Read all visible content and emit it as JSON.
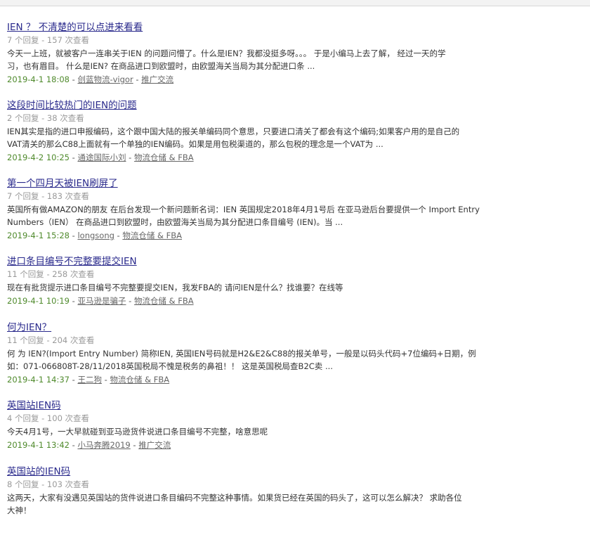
{
  "results": [
    {
      "title": "IEN ？ 不清楚的可以点进来看看",
      "stats": "7 个回复 - 157 次查看",
      "snippet": [
        "今天一上班，就被客户一连串关于IEN 的问题问懵了。什么是IEN？我都没挺多呀。。。 于是小编马上去了解， 经过一天的学",
        "习，也有眉目。 什么是IEN? 在商品进口到欧盟时，由欧盟海关当局为其分配进口条 ..."
      ],
      "date": "2019-4-1 18:08",
      "author": "创蓝物流-vigor",
      "forum": "推广交流"
    },
    {
      "title": "这段时间比较热门的IEN的问题",
      "stats": "2 个回复 - 38 次查看",
      "snippet": [
        "IEN其实是指的进口申报编码，这个跟中国大陆的报关单编码同个意思，只要进口清关了都会有这个编码;如果客户用的是自己的",
        "VAT清关的那么C88上面就有一个单独的IEN编码。如果是用包税渠道的，那么包税的理念是一个VAT为 ..."
      ],
      "date": "2019-4-2 10:25",
      "author": "通途国际小刘",
      "forum": "物流仓储 & FBA"
    },
    {
      "title": "第一个四月天被IEN刷屏了",
      "stats": "7 个回复 - 183 次查看",
      "snippet": [
        "英国所有做AMAZON的朋友 在后台发现一个新问题新名词：IEN 英国规定2018年4月1号后 在亚马逊后台要提供一个 Import Entry",
        "Numbers（IEN） 在商品进口到欧盟时，由欧盟海关当局为其分配进口条目编号 (IEN)。当 ..."
      ],
      "date": "2019-4-1 15:28",
      "author": "longsong",
      "forum": "物流仓储 & FBA"
    },
    {
      "title": "进口条目编号不完整要提交IEN",
      "stats": "11 个回复 - 258 次查看",
      "snippet": [
        "现在有批货提示进口条目编号不完整要提交IEN，我发FBA的 请问IEN是什么？找谁要？在线等"
      ],
      "date": "2019-4-1 10:19",
      "author": "亚马逊是骗子",
      "forum": "物流仓储 & FBA"
    },
    {
      "title": "何为IEN？",
      "stats": "11 个回复 - 204 次查看",
      "snippet": [
        "何 为 IEN?(Import Entry Number) 简称IEN, 英国IEN号码就是H2&E2&C88的报关单号，一般是以码头代码+7位编码+日期，例",
        "如：071-066808T-28/11/2018英国税局不愧是税务的鼻祖！！ 这是英国税局查B2C卖 ..."
      ],
      "date": "2019-4-1 14:37",
      "author": "王二狗",
      "forum": "物流仓储 & FBA"
    },
    {
      "title": "英国站IEN码",
      "stats": "4 个回复 - 100 次查看",
      "snippet": [
        "今天4月1号，一大早就碰到亚马逊货件说进口条目编号不完整，啥意思呢"
      ],
      "date": "2019-4-1 13:42",
      "author": "小马奔腾2019",
      "forum": "推广交流"
    },
    {
      "title": "英国站的IEN码",
      "stats": "8 个回复 - 103 次查看",
      "snippet": [
        "这两天，大家有没遇见英国站的货件说进口条目编码不完整这种事情。如果货已经在英国的码头了，这可以怎么解决？ 求助各位",
        "大神！"
      ],
      "date": "",
      "author": "",
      "forum": ""
    }
  ]
}
